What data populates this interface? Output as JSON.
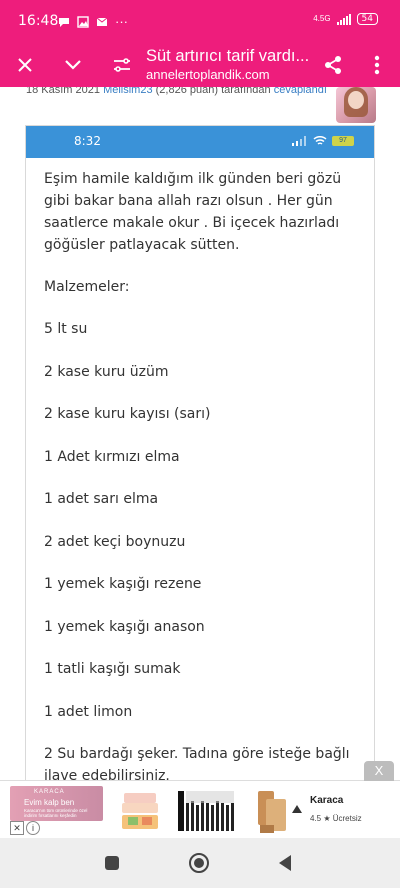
{
  "status_bar": {
    "time": "16:48",
    "network": "4.5G",
    "battery": "54",
    "dots": "···"
  },
  "app_bar": {
    "title": "Süt artırıcı tarif vardı...",
    "url": "annelertoplandik.com"
  },
  "post_meta": {
    "date": "18 Kasım 2021",
    "user": "Melisim23",
    "points": "(2,826 puan)",
    "middle": "tarafından",
    "action": "cevaplandı"
  },
  "embedded_screenshot": {
    "time": "8:32",
    "battery": "97",
    "intro": "Eşim hamile kaldığım ilk günden beri gözü gibi bakar bana allah razı olsun . Her gün saatlerce makale okur . Bi içecek hazırladı göğüsler patlayacak sütten.",
    "heading": "Malzemeler:",
    "items": [
      "5 lt su",
      "2  kase kuru üzüm",
      "2  kase kuru kayısı (sarı)",
      "1 Adet kırmızı elma",
      "1 adet sarı elma",
      "2 adet keçi boynuzu",
      "1 yemek kaşığı rezene",
      "1 yemek kaşığı anason",
      "1 tatli kaşığı sumak",
      "1 adet limon",
      "2 Su bardağı şeker.  Tadına göre isteğe bağlı ilave edebilirsiniz."
    ]
  },
  "ad": {
    "close": "X",
    "brand_small": "KARACA",
    "slogan": "Evim kalp ben",
    "small_text": "Karaca'nın tüm ürünlerinde özel indirim fırsatlarını keşfedin",
    "brand": "Karaca",
    "rating": "4.5 ★ Ücretsiz",
    "icon_close": "✕",
    "icon_info": "i"
  },
  "colors": {
    "primary": "#ee1d7c",
    "phone_bar": "#3a92d8",
    "link": "#3b7fc4"
  }
}
